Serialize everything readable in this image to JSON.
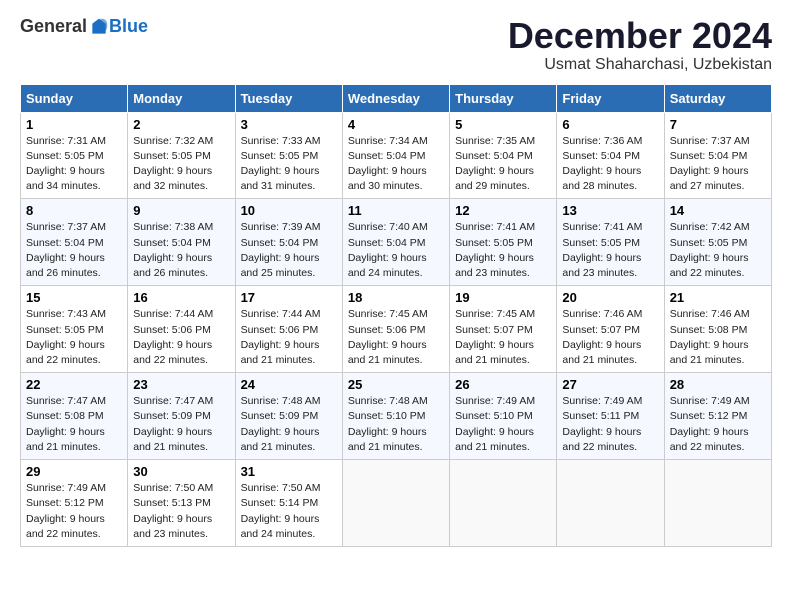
{
  "logo": {
    "general": "General",
    "blue": "Blue"
  },
  "title": {
    "month": "December 2024",
    "location": "Usmat Shaharchasi, Uzbekistan"
  },
  "headers": [
    "Sunday",
    "Monday",
    "Tuesday",
    "Wednesday",
    "Thursday",
    "Friday",
    "Saturday"
  ],
  "weeks": [
    [
      {
        "day": "1",
        "sunrise": "Sunrise: 7:31 AM",
        "sunset": "Sunset: 5:05 PM",
        "daylight": "Daylight: 9 hours and 34 minutes."
      },
      {
        "day": "2",
        "sunrise": "Sunrise: 7:32 AM",
        "sunset": "Sunset: 5:05 PM",
        "daylight": "Daylight: 9 hours and 32 minutes."
      },
      {
        "day": "3",
        "sunrise": "Sunrise: 7:33 AM",
        "sunset": "Sunset: 5:05 PM",
        "daylight": "Daylight: 9 hours and 31 minutes."
      },
      {
        "day": "4",
        "sunrise": "Sunrise: 7:34 AM",
        "sunset": "Sunset: 5:04 PM",
        "daylight": "Daylight: 9 hours and 30 minutes."
      },
      {
        "day": "5",
        "sunrise": "Sunrise: 7:35 AM",
        "sunset": "Sunset: 5:04 PM",
        "daylight": "Daylight: 9 hours and 29 minutes."
      },
      {
        "day": "6",
        "sunrise": "Sunrise: 7:36 AM",
        "sunset": "Sunset: 5:04 PM",
        "daylight": "Daylight: 9 hours and 28 minutes."
      },
      {
        "day": "7",
        "sunrise": "Sunrise: 7:37 AM",
        "sunset": "Sunset: 5:04 PM",
        "daylight": "Daylight: 9 hours and 27 minutes."
      }
    ],
    [
      {
        "day": "8",
        "sunrise": "Sunrise: 7:37 AM",
        "sunset": "Sunset: 5:04 PM",
        "daylight": "Daylight: 9 hours and 26 minutes."
      },
      {
        "day": "9",
        "sunrise": "Sunrise: 7:38 AM",
        "sunset": "Sunset: 5:04 PM",
        "daylight": "Daylight: 9 hours and 26 minutes."
      },
      {
        "day": "10",
        "sunrise": "Sunrise: 7:39 AM",
        "sunset": "Sunset: 5:04 PM",
        "daylight": "Daylight: 9 hours and 25 minutes."
      },
      {
        "day": "11",
        "sunrise": "Sunrise: 7:40 AM",
        "sunset": "Sunset: 5:04 PM",
        "daylight": "Daylight: 9 hours and 24 minutes."
      },
      {
        "day": "12",
        "sunrise": "Sunrise: 7:41 AM",
        "sunset": "Sunset: 5:05 PM",
        "daylight": "Daylight: 9 hours and 23 minutes."
      },
      {
        "day": "13",
        "sunrise": "Sunrise: 7:41 AM",
        "sunset": "Sunset: 5:05 PM",
        "daylight": "Daylight: 9 hours and 23 minutes."
      },
      {
        "day": "14",
        "sunrise": "Sunrise: 7:42 AM",
        "sunset": "Sunset: 5:05 PM",
        "daylight": "Daylight: 9 hours and 22 minutes."
      }
    ],
    [
      {
        "day": "15",
        "sunrise": "Sunrise: 7:43 AM",
        "sunset": "Sunset: 5:05 PM",
        "daylight": "Daylight: 9 hours and 22 minutes."
      },
      {
        "day": "16",
        "sunrise": "Sunrise: 7:44 AM",
        "sunset": "Sunset: 5:06 PM",
        "daylight": "Daylight: 9 hours and 22 minutes."
      },
      {
        "day": "17",
        "sunrise": "Sunrise: 7:44 AM",
        "sunset": "Sunset: 5:06 PM",
        "daylight": "Daylight: 9 hours and 21 minutes."
      },
      {
        "day": "18",
        "sunrise": "Sunrise: 7:45 AM",
        "sunset": "Sunset: 5:06 PM",
        "daylight": "Daylight: 9 hours and 21 minutes."
      },
      {
        "day": "19",
        "sunrise": "Sunrise: 7:45 AM",
        "sunset": "Sunset: 5:07 PM",
        "daylight": "Daylight: 9 hours and 21 minutes."
      },
      {
        "day": "20",
        "sunrise": "Sunrise: 7:46 AM",
        "sunset": "Sunset: 5:07 PM",
        "daylight": "Daylight: 9 hours and 21 minutes."
      },
      {
        "day": "21",
        "sunrise": "Sunrise: 7:46 AM",
        "sunset": "Sunset: 5:08 PM",
        "daylight": "Daylight: 9 hours and 21 minutes."
      }
    ],
    [
      {
        "day": "22",
        "sunrise": "Sunrise: 7:47 AM",
        "sunset": "Sunset: 5:08 PM",
        "daylight": "Daylight: 9 hours and 21 minutes."
      },
      {
        "day": "23",
        "sunrise": "Sunrise: 7:47 AM",
        "sunset": "Sunset: 5:09 PM",
        "daylight": "Daylight: 9 hours and 21 minutes."
      },
      {
        "day": "24",
        "sunrise": "Sunrise: 7:48 AM",
        "sunset": "Sunset: 5:09 PM",
        "daylight": "Daylight: 9 hours and 21 minutes."
      },
      {
        "day": "25",
        "sunrise": "Sunrise: 7:48 AM",
        "sunset": "Sunset: 5:10 PM",
        "daylight": "Daylight: 9 hours and 21 minutes."
      },
      {
        "day": "26",
        "sunrise": "Sunrise: 7:49 AM",
        "sunset": "Sunset: 5:10 PM",
        "daylight": "Daylight: 9 hours and 21 minutes."
      },
      {
        "day": "27",
        "sunrise": "Sunrise: 7:49 AM",
        "sunset": "Sunset: 5:11 PM",
        "daylight": "Daylight: 9 hours and 22 minutes."
      },
      {
        "day": "28",
        "sunrise": "Sunrise: 7:49 AM",
        "sunset": "Sunset: 5:12 PM",
        "daylight": "Daylight: 9 hours and 22 minutes."
      }
    ],
    [
      {
        "day": "29",
        "sunrise": "Sunrise: 7:49 AM",
        "sunset": "Sunset: 5:12 PM",
        "daylight": "Daylight: 9 hours and 22 minutes."
      },
      {
        "day": "30",
        "sunrise": "Sunrise: 7:50 AM",
        "sunset": "Sunset: 5:13 PM",
        "daylight": "Daylight: 9 hours and 23 minutes."
      },
      {
        "day": "31",
        "sunrise": "Sunrise: 7:50 AM",
        "sunset": "Sunset: 5:14 PM",
        "daylight": "Daylight: 9 hours and 24 minutes."
      },
      null,
      null,
      null,
      null
    ]
  ]
}
